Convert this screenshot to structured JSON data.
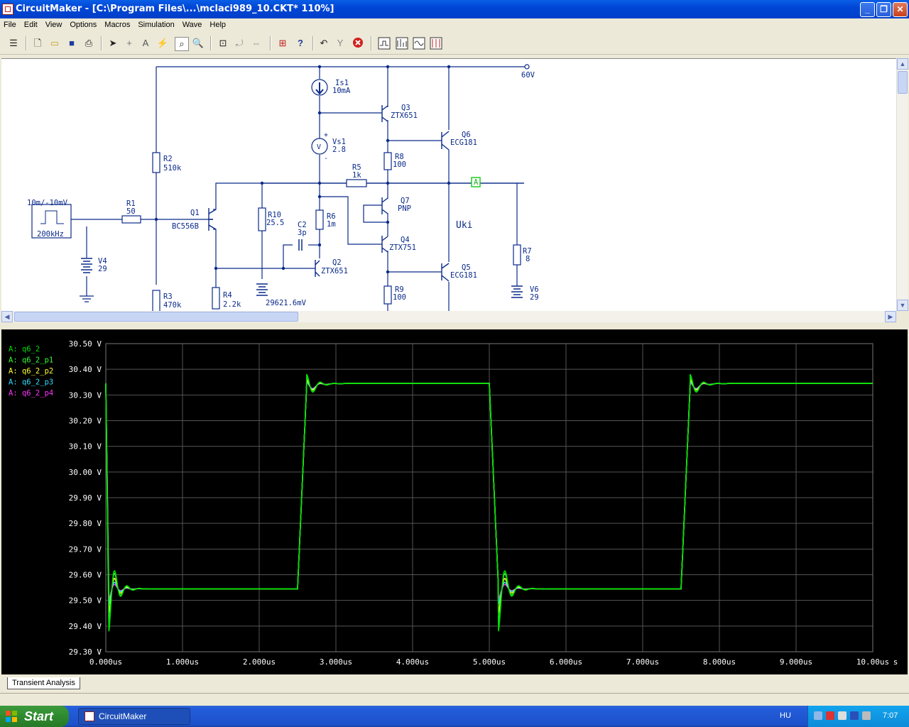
{
  "window": {
    "title": "CircuitMaker - [C:\\Program Files\\...\\mclaci989_10.CKT* 110%]"
  },
  "menu": [
    "File",
    "Edit",
    "View",
    "Options",
    "Macros",
    "Simulation",
    "Wave",
    "Help"
  ],
  "toolbar": {
    "icons": [
      "schematic-icon",
      "new-icon",
      "open-icon",
      "save-icon",
      "print-icon",
      "arrow-icon",
      "wire-icon",
      "text-icon",
      "probe-icon",
      "zoom-icon",
      "magnify-icon",
      "fit-icon",
      "rotate-icon",
      "mirror-icon",
      "digital-icon",
      "help-icon",
      "undo-icon",
      "trace-icon",
      "stop-icon",
      "analysis1-icon",
      "analysis2-icon",
      "analysis3-icon",
      "analysis4-icon"
    ]
  },
  "schematic": {
    "labels": {
      "rail": "60V",
      "is1_name": "Is1",
      "is1_val": "10mA",
      "vs1_name": "Vs1",
      "vs1_val": "2.8",
      "q3_name": "Q3",
      "q3_val": "ZTX651",
      "q6_name": "Q6",
      "q6_val": "ECG181",
      "r2_name": "R2",
      "r2_val": "510k",
      "r8_name": "R8",
      "r8_val": "100",
      "r5_name": "R5",
      "r5_val": "1k",
      "node_a": "A",
      "gen_label": "10m/-10mV",
      "gen_freq": "200kHz",
      "r1_name": "R1",
      "r1_val": "50",
      "q1_name": "Q1",
      "q1_val": "BC556B",
      "r10_name": "R10",
      "r10_val": "25.5",
      "c2_name": "C2",
      "c2_val": "3p",
      "r6_name": "R6",
      "r6_val": "1m",
      "q7_name": "Q7",
      "q7_val": "PNP",
      "q4_name": "Q4",
      "q4_val": "ZTX751",
      "uki": "Uki",
      "r7_name": "R7",
      "r7_val": "8",
      "v4_name": "V4",
      "v4_val": "29",
      "q2_name": "Q2",
      "q2_val": "ZTX651",
      "q5_name": "Q5",
      "q5_val": "ECG181",
      "r3_name": "R3",
      "r3_val": "470k",
      "r4_name": "R4",
      "r4_val": "2.2k",
      "bat_val": "29621.6mV",
      "r9_name": "R9",
      "r9_val": "100",
      "v6_name": "V6",
      "v6_val": "29"
    }
  },
  "chart_data": {
    "type": "line",
    "x_ticks": [
      "0.000us",
      "1.000us",
      "2.000us",
      "3.000us",
      "4.000us",
      "5.000us",
      "6.000us",
      "7.000us",
      "8.000us",
      "9.000us",
      "10.00us"
    ],
    "x_unit": "s",
    "y_ticks": [
      "30.50 V",
      "30.40 V",
      "30.30 V",
      "30.20 V",
      "30.10 V",
      "30.00 V",
      "29.90 V",
      "29.80 V",
      "29.70 V",
      "29.60 V",
      "29.50 V",
      "29.40 V",
      "29.30 V"
    ],
    "xlim": [
      0,
      10
    ],
    "ylim": [
      29.3,
      30.5
    ],
    "grid": true,
    "legend_position": "top-left",
    "high_level": 30.345,
    "low_level": 29.545,
    "transitions_us": [
      0.0,
      2.5,
      5.0,
      7.5
    ],
    "series": [
      {
        "name": "A: q6_2",
        "color": "#00dd00",
        "overshoot": 0.035,
        "undershoot": 0.165
      },
      {
        "name": "A: q6_2_p1",
        "color": "#33ff33",
        "overshoot": 0.03,
        "undershoot": 0.14
      },
      {
        "name": "A: q6_2_p2",
        "color": "#ffff33",
        "overshoot": 0.015,
        "undershoot": 0.095
      },
      {
        "name": "A: q6_2_p3",
        "color": "#33ddff",
        "overshoot": 0.008,
        "undershoot": 0.06
      },
      {
        "name": "A: q6_2_p4",
        "color": "#ff33ff",
        "overshoot": 0.003,
        "undershoot": 0.04
      }
    ]
  },
  "tabs": {
    "active": "Transient Analysis"
  },
  "taskbar": {
    "start": "Start",
    "task": "CircuitMaker",
    "lang": "HU",
    "clock": "7:07"
  }
}
